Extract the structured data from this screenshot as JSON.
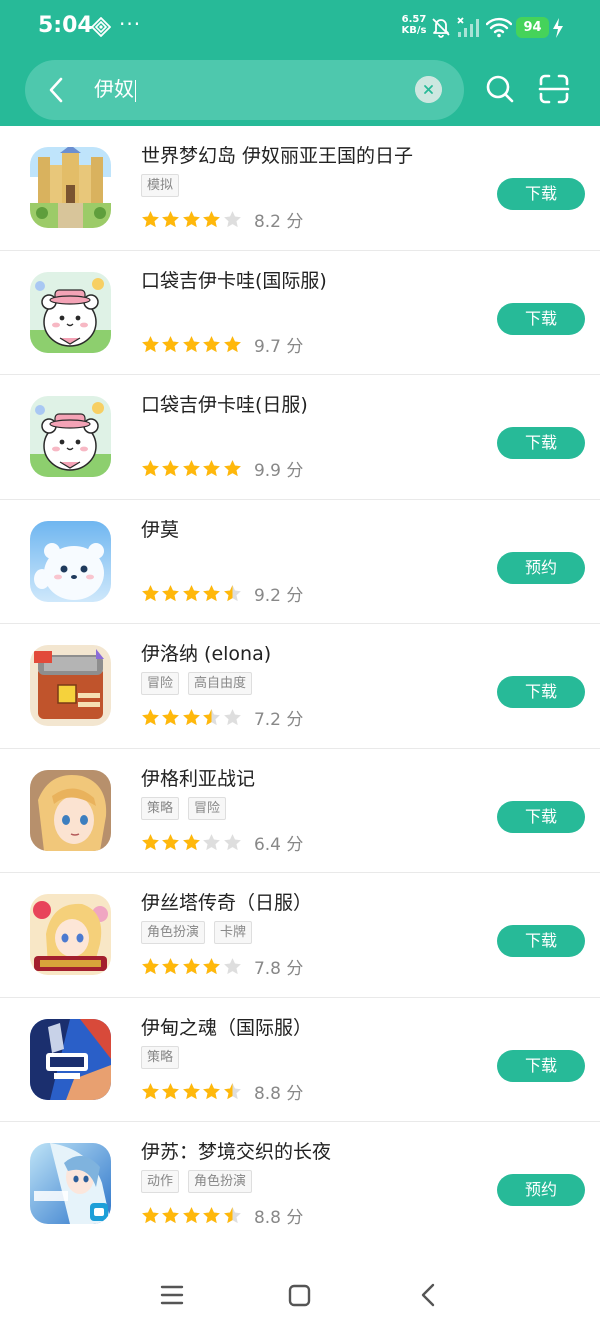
{
  "status_bar": {
    "time": "5:04",
    "net_speed_value": "6.57",
    "net_speed_unit": "KB/s",
    "battery": "94",
    "icons": [
      "nfc-icon",
      "more-dots-icon",
      "mute-bell-icon",
      "signal-icon",
      "wifi-icon",
      "charging-icon"
    ]
  },
  "search": {
    "query": "伊奴",
    "icons": [
      "back-arrow-icon",
      "clear-icon",
      "search-icon",
      "scan-icon"
    ]
  },
  "colors": {
    "brand_green": "#27ba98",
    "star_gold": "#ffb80b",
    "star_empty": "#dedede"
  },
  "apps": [
    {
      "title": "世界梦幻岛 伊奴丽亚王国的日子",
      "tags": [
        "模拟"
      ],
      "rating": 4,
      "score": "8.2 分",
      "action": "下载",
      "icon": "castle-town-game-icon"
    },
    {
      "title": "口袋吉伊卡哇(国际服)",
      "tags": [],
      "rating": 5,
      "score": "9.7 分",
      "action": "下载",
      "icon": "white-bear-pink-hat-icon"
    },
    {
      "title": "口袋吉伊卡哇(日服)",
      "tags": [],
      "rating": 5,
      "score": "9.9 分",
      "action": "下载",
      "icon": "white-bear-pink-hat-icon"
    },
    {
      "title": "伊莫",
      "tags": [],
      "rating": 4.5,
      "score": "9.2 分",
      "action": "预约",
      "icon": "white-bear-waving-icon"
    },
    {
      "title": "伊洛纳 (elona)",
      "tags": [
        "冒险",
        "高自由度"
      ],
      "rating": 3.5,
      "score": "7.2 分",
      "action": "下载",
      "icon": "elona-chest-icon"
    },
    {
      "title": "伊格利亚战记",
      "tags": [
        "策略",
        "冒险"
      ],
      "rating": 3,
      "score": "6.4 分",
      "action": "下载",
      "icon": "blonde-knight-portrait-icon"
    },
    {
      "title": "伊丝塔传奇（日服）",
      "tags": [
        "角色扮演",
        "卡牌"
      ],
      "rating": 4,
      "score": "7.8 分",
      "action": "下载",
      "icon": "anime-girl-anniversary-icon"
    },
    {
      "title": "伊甸之魂（国际服）",
      "tags": [
        "策略"
      ],
      "rating": 4.5,
      "score": "8.8 分",
      "action": "下载",
      "icon": "2v2-fight-now-icon"
    },
    {
      "title": "伊苏：梦境交织的长夜",
      "tags": [
        "动作",
        "角色扮演"
      ],
      "rating": 4.5,
      "score": "8.8 分",
      "action": "预约",
      "icon": "ys-viii-heroine-icon"
    }
  ],
  "nav_bar": {
    "icons": [
      "menu-icon",
      "home-square-icon",
      "back-chevron-icon"
    ]
  }
}
